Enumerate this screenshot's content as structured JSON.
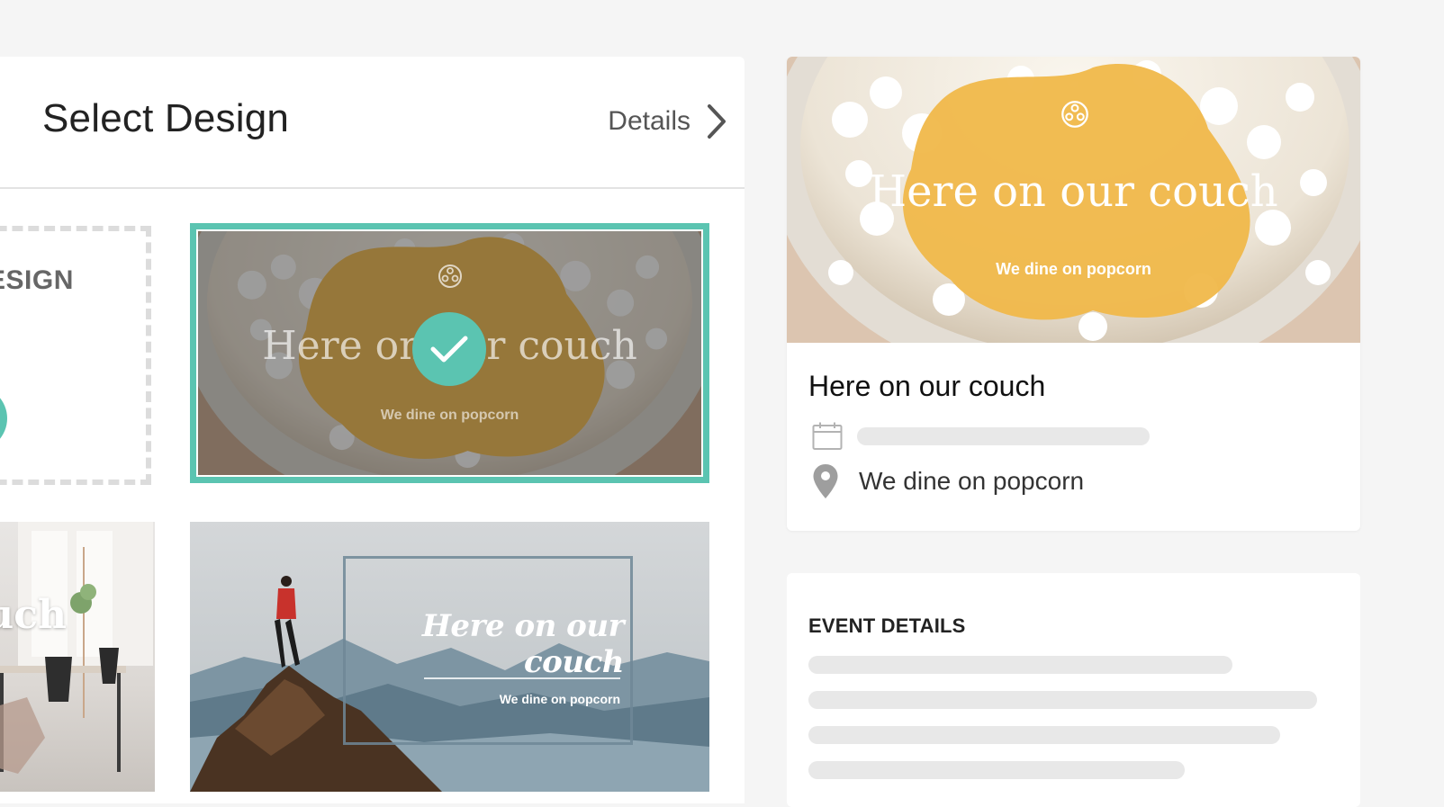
{
  "left_panel": {
    "title": "Select Design",
    "details_label": "Details"
  },
  "designs": {
    "blank_label": "ESIGN",
    "popcorn": {
      "title": "Here on our couch",
      "subtitle": "We dine on popcorn",
      "selected": true
    },
    "office_text": "uch",
    "mountain": {
      "title": "Here on our couch",
      "subtitle": "We dine on popcorn"
    }
  },
  "preview": {
    "hero_title": "Here on our couch",
    "hero_subtitle": "We dine on popcorn",
    "event_title": "Here on our couch",
    "location": "We dine on popcorn"
  },
  "event_details": {
    "heading": "EVENT DETAILS"
  },
  "colors": {
    "accent": "#5bc4b1",
    "blob": "#f0b84a",
    "background": "#f5f5f5"
  },
  "icons": [
    "chevron-right-icon",
    "checkmark-icon",
    "film-reel-icon",
    "calendar-icon",
    "location-pin-icon"
  ]
}
